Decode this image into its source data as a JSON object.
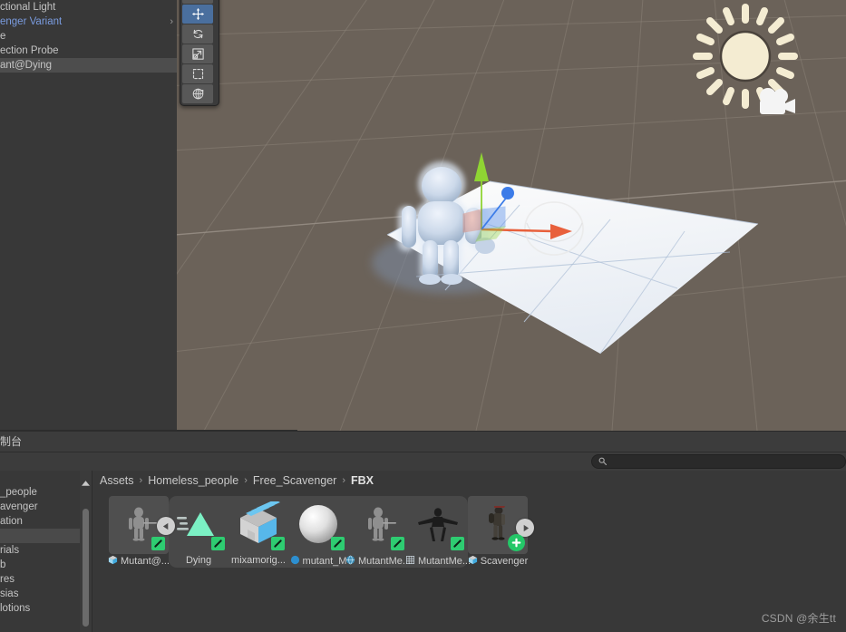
{
  "hierarchy": {
    "items": [
      {
        "label": "ctional Light",
        "kind": "gameobject",
        "selected": false,
        "prefab": false,
        "expandable": false
      },
      {
        "label": "enger Variant",
        "kind": "prefab-variant",
        "selected": false,
        "prefab": true,
        "expandable": true
      },
      {
        "label": "e",
        "kind": "gameobject",
        "selected": false,
        "prefab": false,
        "expandable": false
      },
      {
        "label": "ection Probe",
        "kind": "gameobject",
        "selected": false,
        "prefab": false,
        "expandable": false
      },
      {
        "label": "ant@Dying",
        "kind": "gameobject",
        "selected": true,
        "prefab": false,
        "expandable": false
      }
    ],
    "chevron_glyph": "›"
  },
  "scene": {
    "background_color": "#6b6259",
    "grid_color": "#8b8278",
    "tools": [
      {
        "name": "hand-tool",
        "tooltip": "Hand Tool",
        "active": false
      },
      {
        "name": "move-tool",
        "tooltip": "Move Tool",
        "active": true
      },
      {
        "name": "rotate-tool",
        "tooltip": "Rotate Tool",
        "active": false
      },
      {
        "name": "scale-tool",
        "tooltip": "Scale Tool",
        "active": false
      },
      {
        "name": "rect-tool",
        "tooltip": "Rect Tool",
        "active": false
      },
      {
        "name": "transform-tool",
        "tooltip": "Transform Tool",
        "active": false
      }
    ],
    "gizmos": {
      "sun": "directional-light-gizmo",
      "camera": "camera-gizmo",
      "move_handle": "move-gizmo",
      "axis_x_color": "#e8603c",
      "axis_y_color": "#8fd433",
      "axis_z_color": "#3c7ce8"
    }
  },
  "console": {
    "tab_label": "制台"
  },
  "search": {
    "placeholder": "",
    "value": "",
    "icon": "search-icon"
  },
  "project": {
    "tree": [
      {
        "label": "",
        "selected": false
      },
      {
        "label": "_people",
        "selected": false
      },
      {
        "label": "avenger",
        "selected": false
      },
      {
        "label": "ation",
        "selected": false
      },
      {
        "label": "",
        "selected": true
      },
      {
        "label": "rials",
        "selected": false
      },
      {
        "label": "b",
        "selected": false
      },
      {
        "label": "res",
        "selected": false
      },
      {
        "label": "sias",
        "selected": false
      },
      {
        "label": "lotions",
        "selected": false
      }
    ],
    "breadcrumb": [
      {
        "label": "Assets",
        "current": false
      },
      {
        "label": "Homeless_people",
        "current": false
      },
      {
        "label": "Free_Scavenger",
        "current": false
      },
      {
        "label": "FBX",
        "current": true
      }
    ],
    "breadcrumb_separator": "›",
    "assets": [
      {
        "label": "Mutant@...",
        "icon": "prefab-icon",
        "thumb": "character-model",
        "checked": true,
        "selected": true,
        "back_badge": true,
        "play_badge": false,
        "plus_badge": false,
        "grouped": false
      },
      {
        "label": "Dying",
        "icon": "",
        "thumb": "animation-clip",
        "checked": true,
        "selected": false,
        "back_badge": false,
        "play_badge": false,
        "plus_badge": false,
        "grouped": true
      },
      {
        "label": "mixamorig...",
        "icon": "",
        "thumb": "avatar-box",
        "checked": true,
        "selected": false,
        "back_badge": false,
        "play_badge": false,
        "plus_badge": false,
        "grouped": true
      },
      {
        "label": "mutant_M",
        "icon": "material-icon",
        "thumb": "material-sphere",
        "checked": true,
        "selected": false,
        "back_badge": false,
        "play_badge": false,
        "plus_badge": false,
        "grouped": true
      },
      {
        "label": "MutantMe...",
        "icon": "avatar-icon",
        "thumb": "character-model",
        "checked": true,
        "selected": false,
        "back_badge": false,
        "play_badge": false,
        "plus_badge": false,
        "grouped": true
      },
      {
        "label": "MutantMe...",
        "icon": "mesh-icon",
        "thumb": "mesh-silhouette",
        "checked": true,
        "selected": false,
        "back_badge": false,
        "play_badge": false,
        "plus_badge": false,
        "grouped": true
      },
      {
        "label": "Scavenger",
        "icon": "prefab-icon",
        "thumb": "scavenger-model",
        "checked": false,
        "selected": true,
        "back_badge": false,
        "play_badge": true,
        "plus_badge": true,
        "grouped": false
      }
    ]
  },
  "watermark": {
    "text": "CSDN @余生tt"
  }
}
